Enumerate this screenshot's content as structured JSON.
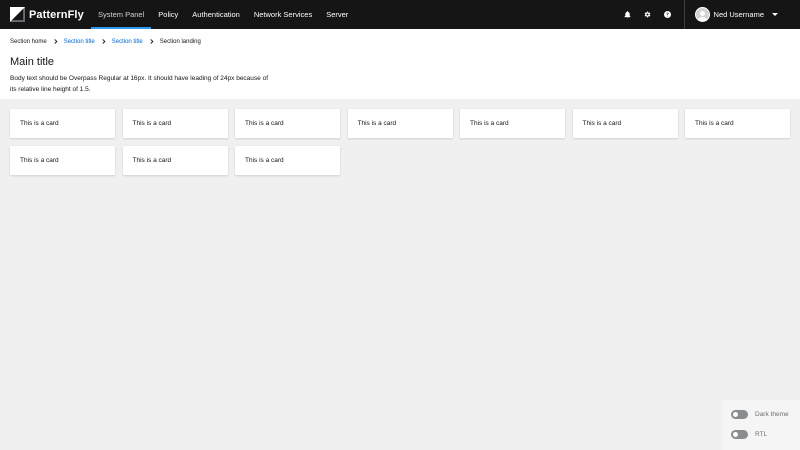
{
  "brand": {
    "name": "PatternFly"
  },
  "nav": {
    "items": [
      {
        "label": "System Panel",
        "active": true
      },
      {
        "label": "Policy"
      },
      {
        "label": "Authentication"
      },
      {
        "label": "Network Services"
      },
      {
        "label": "Server"
      }
    ]
  },
  "tools": {
    "icons": [
      "bell-icon",
      "gear-icon",
      "help-icon"
    ]
  },
  "user": {
    "name": "Ned Username"
  },
  "breadcrumb": {
    "items": [
      {
        "label": "Section home",
        "link": false
      },
      {
        "label": "Section title",
        "link": true
      },
      {
        "label": "Section title",
        "link": true
      },
      {
        "label": "Section landing",
        "link": false
      }
    ]
  },
  "page": {
    "title": "Main title",
    "body": "Body text should be Overpass Regular at 16px. It should have leading of 24px because of its relative line height of 1.5."
  },
  "cards": [
    "This is a card",
    "This is a card",
    "This is a card",
    "This is a card",
    "This is a card",
    "This is a card",
    "This is a card",
    "This is a card",
    "This is a card",
    "This is a card"
  ],
  "theme_panel": {
    "dark_theme_label": "Dark theme",
    "rtl_label": "RTL"
  },
  "colors": {
    "masthead": "#151515",
    "link": "#0066cc",
    "active_nav": "#2b9af3",
    "background": "#f0f0f0"
  }
}
